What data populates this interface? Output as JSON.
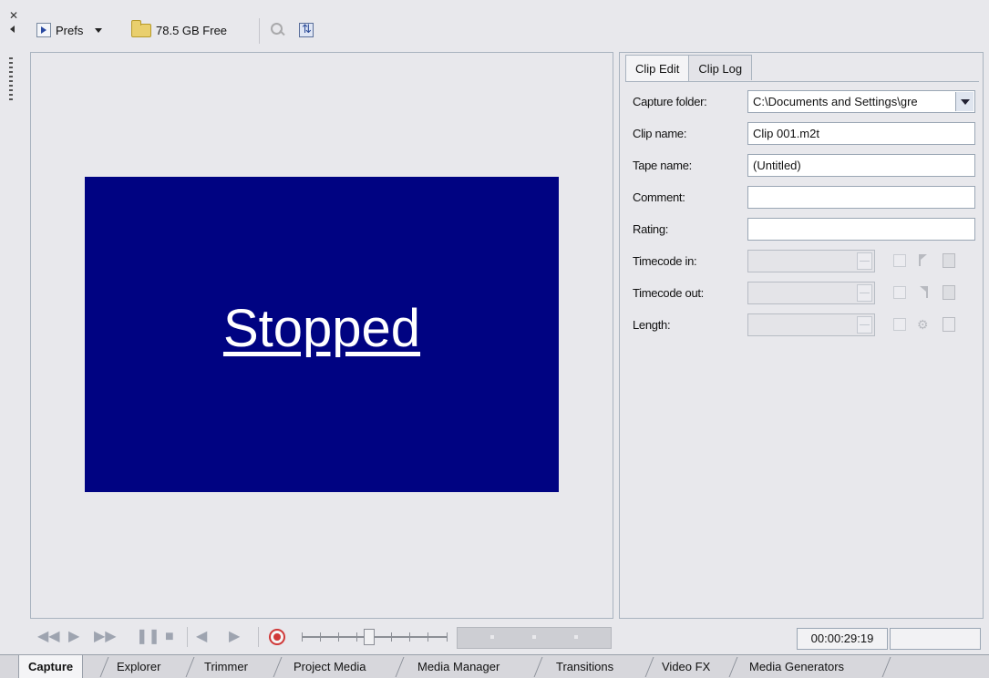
{
  "toolbar": {
    "prefs_label": "Prefs",
    "free_space": "78.5 GB Free",
    "icons": [
      "prefs-icon",
      "dropdown-caret-icon",
      "folder-icon",
      "magnifier-icon",
      "refresh-icon"
    ]
  },
  "preview": {
    "status_text": "Stopped",
    "screen_color": "#000382"
  },
  "clip_panel": {
    "tabs": [
      {
        "label": "Clip Edit",
        "active": true
      },
      {
        "label": "Clip Log",
        "active": false
      }
    ],
    "fields": {
      "capture_folder": {
        "label": "Capture folder:",
        "value": "C:\\Documents and Settings\\gre"
      },
      "clip_name": {
        "label": "Clip name:",
        "value": "Clip 001.m2t"
      },
      "tape_name": {
        "label": "Tape name:",
        "value": "(Untitled)"
      },
      "comment": {
        "label": "Comment:",
        "value": ""
      },
      "rating": {
        "label": "Rating:",
        "value": ""
      },
      "timecode_in": {
        "label": "Timecode in:",
        "value": ""
      },
      "timecode_out": {
        "label": "Timecode out:",
        "value": ""
      },
      "length": {
        "label": "Length:",
        "value": ""
      }
    }
  },
  "transport": {
    "buttons": [
      "rewind",
      "play",
      "fast-forward",
      "pause",
      "stop",
      "prev-frame",
      "next-frame",
      "record"
    ],
    "glyphs": {
      "rewind": "◀◀",
      "play": "▶",
      "fast_forward": "▶▶",
      "pause": "❚❚",
      "stop": "■",
      "prev_frame": "◀",
      "next_frame": "▶"
    },
    "accent_color": "#d03838"
  },
  "timecode_display": "00:00:29:19",
  "window_tabs": [
    {
      "label": "Capture",
      "active": true
    },
    {
      "label": "Explorer",
      "active": false
    },
    {
      "label": "Trimmer",
      "active": false
    },
    {
      "label": "Project Media",
      "active": false
    },
    {
      "label": "Media Manager",
      "active": false
    },
    {
      "label": "Transitions",
      "active": false
    },
    {
      "label": "Video FX",
      "active": false
    },
    {
      "label": "Media Generators",
      "active": false
    }
  ]
}
